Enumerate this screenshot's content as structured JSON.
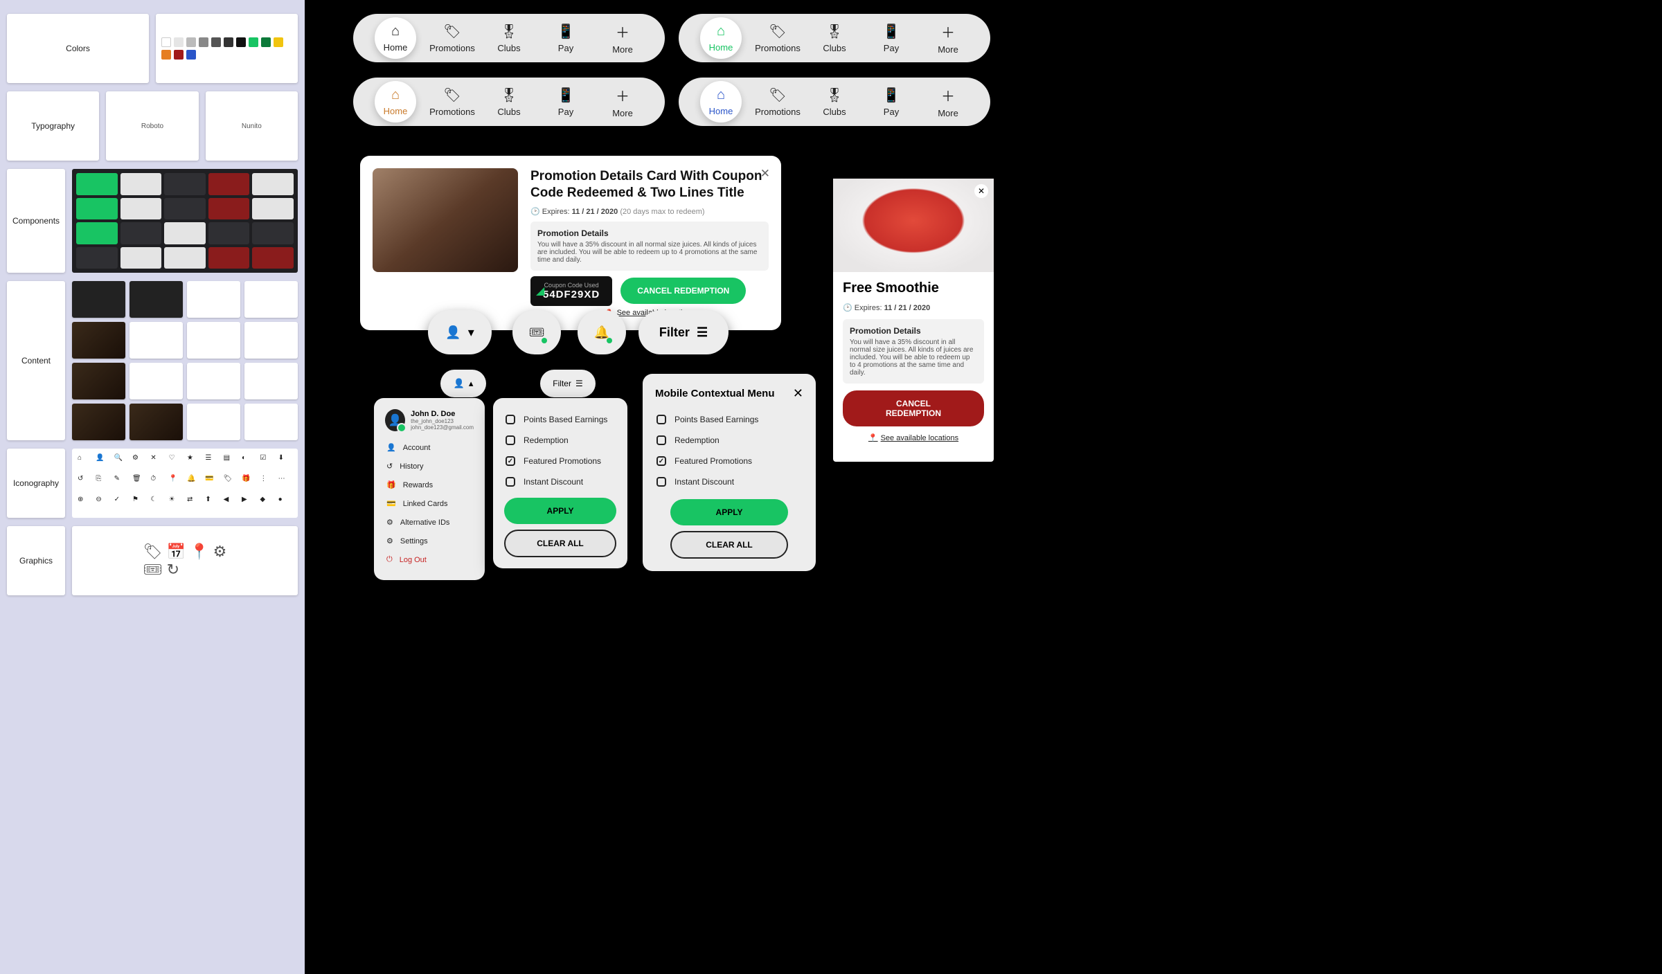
{
  "left_nav": {
    "sections": [
      "Colors",
      "Typography",
      "Components",
      "Content",
      "Iconography",
      "Graphics"
    ],
    "fonts": [
      "Roboto",
      "Nunito"
    ]
  },
  "nav_items": [
    "Home",
    "Promotions",
    "Clubs",
    "Pay",
    "More"
  ],
  "promo": {
    "title": "Promotion Details Card With Coupon Code Redeemed & Two Lines Title",
    "expires_label": "Expires:",
    "expires_date": "11 / 21 / 2020",
    "expires_note": "(20 days max to redeem)",
    "details_title": "Promotion Details",
    "details_body": "You will have a 35% discount in all normal size juices. All kinds of juices are included. You will be able to redeem up to 4 promotions at the same time and daily.",
    "code_label": "Coupon Code Used",
    "code_value": "54DF29XD",
    "cancel_label": "CANCEL REDEMPTION",
    "locations_link": "See available locations"
  },
  "filter_chip_label": "Filter",
  "user_menu": {
    "name": "John D. Doe",
    "handle": "the_john_doe123",
    "email": "john_doe123@gmail.com",
    "items": [
      "Account",
      "History",
      "Rewards",
      "Linked Cards",
      "Alternative IDs",
      "Settings"
    ],
    "logout": "Log Out"
  },
  "filter_menu": {
    "mini_label": "Filter",
    "options": [
      "Points Based Earnings",
      "Redemption",
      "Featured Promotions",
      "Instant Discount"
    ],
    "checked_index": 2,
    "apply": "APPLY",
    "clear": "CLEAR ALL"
  },
  "ctx_menu": {
    "title": "Mobile Contextual Menu",
    "options": [
      "Points Based Earnings",
      "Redemption",
      "Featured Promotions",
      "Instant Discount"
    ],
    "checked_index": 2,
    "apply": "APPLY",
    "clear": "CLEAR ALL"
  },
  "side_promo": {
    "title": "Free Smoothie",
    "expires_label": "Expires:",
    "expires_date": "11 / 21 / 2020",
    "details_title": "Promotion Details",
    "details_body": "You will have a 35% discount in all normal size juices. All kinds of juices are included. You will be able to redeem up to 4 promotions at the same time and daily.",
    "cancel_label": "CANCEL REDEMPTION",
    "locations_link": "See available locations"
  },
  "colors": {
    "green": "#18c463",
    "red": "#a11a1a",
    "orange": "#c97a2a",
    "blue": "#2a55c9",
    "black": "#111"
  }
}
